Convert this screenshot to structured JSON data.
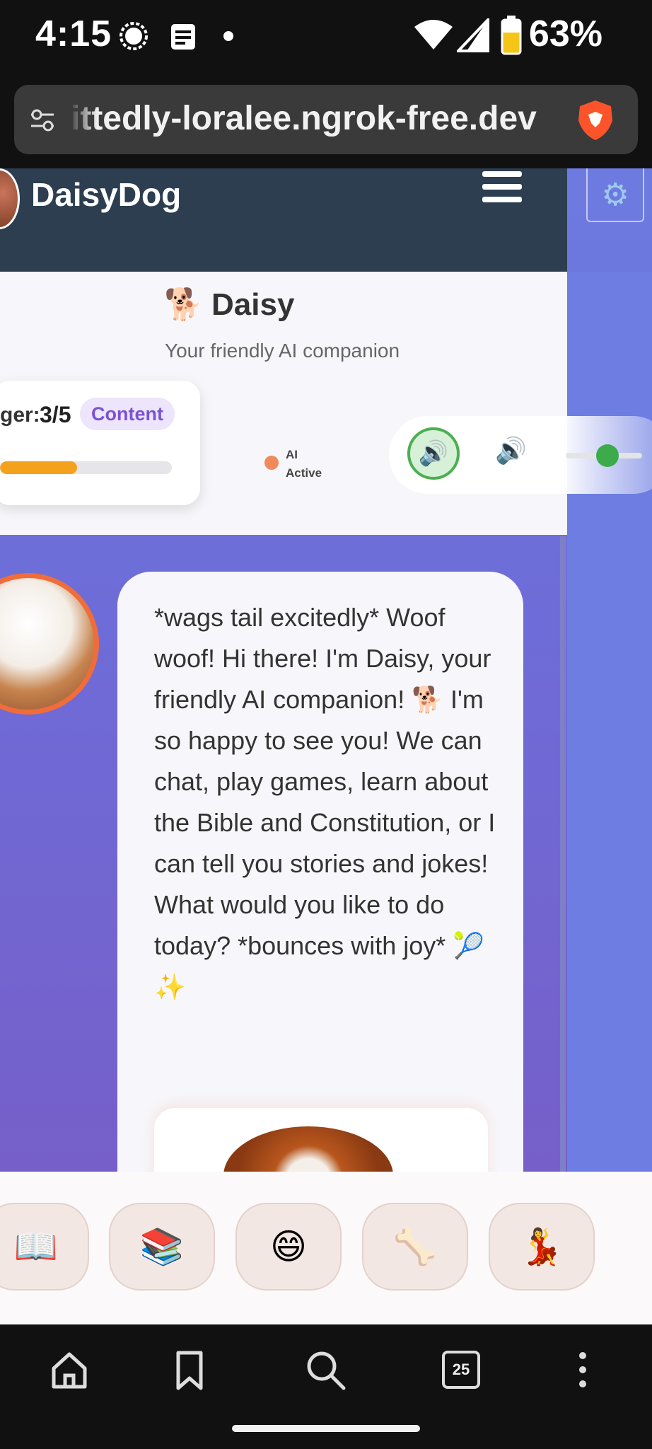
{
  "status_bar": {
    "time": "4:15",
    "battery": "63%",
    "icons": [
      "signal-messenger-icon",
      "notes-icon",
      "dot-icon",
      "wifi-icon",
      "cell-signal-icon",
      "battery-icon"
    ]
  },
  "browser": {
    "url": "ittedly-loralee.ngrok-free.dev",
    "icons": [
      "site-settings-icon",
      "brave-shield-icon"
    ]
  },
  "header": {
    "brand": "DaisyDog"
  },
  "profile": {
    "title": "🐕 Daisy",
    "subtitle": "Your friendly AI companion"
  },
  "stats": {
    "hunger_label": "ger:",
    "hunger_value": "3/5",
    "hunger_fraction": 0.45,
    "mood": "Content"
  },
  "ai_status": {
    "line1": "AI",
    "line2": "Active"
  },
  "controls": {
    "voice_icon": "🔊",
    "speaker_icon": "🔊",
    "volume_level": 0.55
  },
  "chat": {
    "message": "*wags tail excitedly* Woof woof! Hi there! I'm Daisy, your friendly AI companion! 🐕 I'm so happy to see you! We can chat, play games, learn about the Bible and Constitution, or I can tell you stories and jokes! What would you like to do today? *bounces with joy* 🎾✨"
  },
  "quick_actions": [
    "📖",
    "📚",
    "😄",
    "🦴",
    "💃"
  ],
  "bottom_nav": {
    "tab_count": "25",
    "icons": [
      "home-icon",
      "bookmark-icon",
      "search-icon",
      "tabs-icon",
      "more-icon"
    ]
  },
  "colors": {
    "header_bg": "#2c3e50",
    "accent_purple": "#7a52d6",
    "hunger_bar": "#f4a21d",
    "voice_green": "#4caf50",
    "avatar_ring": "#ef6d3a"
  }
}
